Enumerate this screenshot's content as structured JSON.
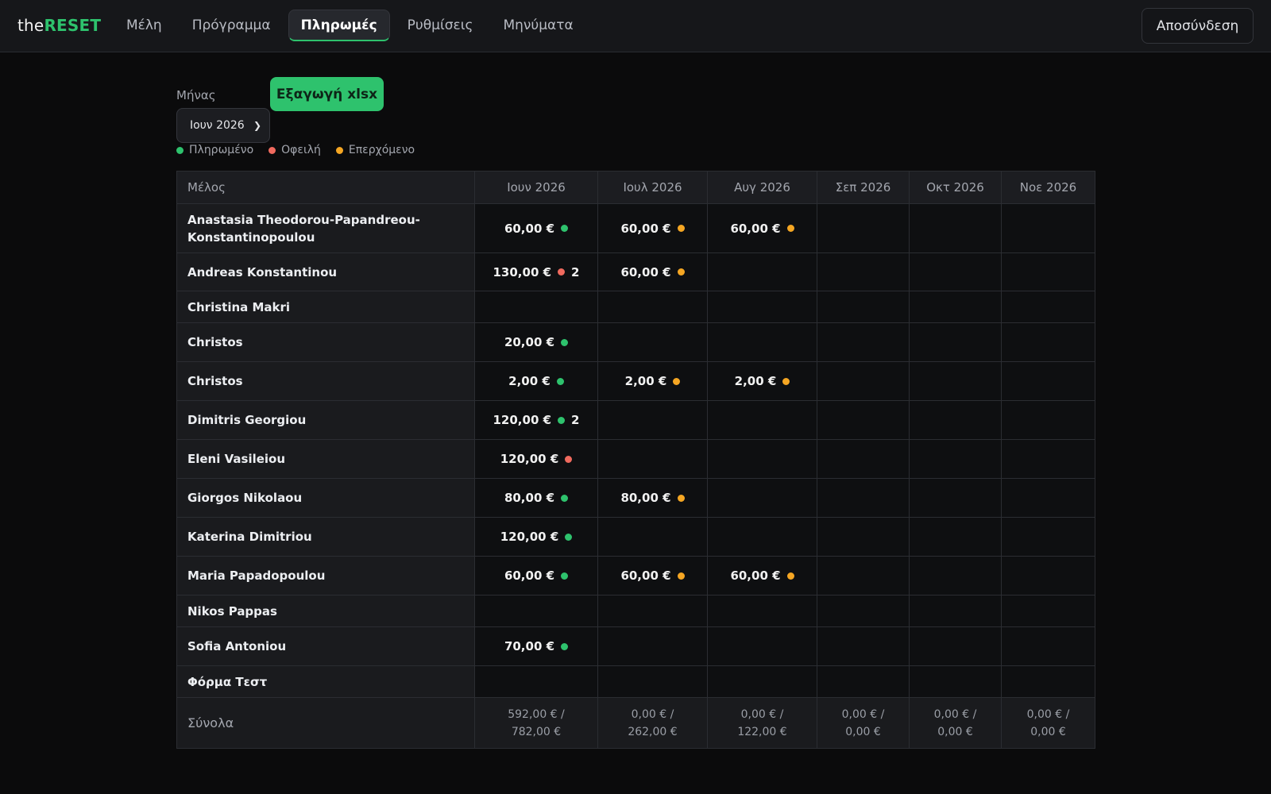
{
  "brand": {
    "prefix": "the",
    "accent": "RESET"
  },
  "nav": {
    "tabs": [
      {
        "label": "Μέλη",
        "active": false
      },
      {
        "label": "Πρόγραμμα",
        "active": false
      },
      {
        "label": "Πληρωμές",
        "active": true
      },
      {
        "label": "Ρυθμίσεις",
        "active": false
      },
      {
        "label": "Μηνύματα",
        "active": false
      }
    ],
    "logout_label": "Αποσύνδεση"
  },
  "controls": {
    "month_label": "Μήνας",
    "selected_month": "Ιουν 2026",
    "export_label": "Εξαγωγή xlsx"
  },
  "legend": [
    {
      "label": "Πληρωμένο",
      "color": "#2ec26d"
    },
    {
      "label": "Οφειλή",
      "color": "#f06a5e"
    },
    {
      "label": "Επερχόμενο",
      "color": "#f5a623"
    }
  ],
  "colors": {
    "paid": "#2ec26d",
    "owed": "#f06a5e",
    "upcoming": "#f5a623"
  },
  "table": {
    "member_header": "Μέλος",
    "months": [
      "Ιουν 2026",
      "Ιουλ 2026",
      "Αυγ 2026",
      "Σεπ 2026",
      "Οκτ 2026",
      "Νοε 2026"
    ],
    "rows": [
      {
        "name": "Anastasia Theodorou-Papandreou-Konstantinopoulou",
        "cells": [
          {
            "amount": "60,00 €",
            "status": "paid"
          },
          {
            "amount": "60,00 €",
            "status": "upcoming"
          },
          {
            "amount": "60,00 €",
            "status": "upcoming"
          },
          null,
          null,
          null
        ]
      },
      {
        "name": "Andreas Konstantinou",
        "cells": [
          {
            "amount": "130,00 €",
            "status": "owed",
            "count": "2"
          },
          {
            "amount": "60,00 €",
            "status": "upcoming"
          },
          null,
          null,
          null,
          null
        ]
      },
      {
        "name": "Christina Makri",
        "cells": [
          null,
          null,
          null,
          null,
          null,
          null
        ]
      },
      {
        "name": "Christos",
        "cells": [
          {
            "amount": "20,00 €",
            "status": "paid"
          },
          null,
          null,
          null,
          null,
          null
        ]
      },
      {
        "name": "Christos",
        "cells": [
          {
            "amount": "2,00 €",
            "status": "paid"
          },
          {
            "amount": "2,00 €",
            "status": "upcoming"
          },
          {
            "amount": "2,00 €",
            "status": "upcoming"
          },
          null,
          null,
          null
        ]
      },
      {
        "name": "Dimitris Georgiou",
        "cells": [
          {
            "amount": "120,00 €",
            "status": "paid",
            "count": "2"
          },
          null,
          null,
          null,
          null,
          null
        ]
      },
      {
        "name": "Eleni Vasileiou",
        "cells": [
          {
            "amount": "120,00 €",
            "status": "owed"
          },
          null,
          null,
          null,
          null,
          null
        ]
      },
      {
        "name": "Giorgos Nikolaou",
        "cells": [
          {
            "amount": "80,00 €",
            "status": "paid"
          },
          {
            "amount": "80,00 €",
            "status": "upcoming"
          },
          null,
          null,
          null,
          null
        ]
      },
      {
        "name": "Katerina Dimitriou",
        "cells": [
          {
            "amount": "120,00 €",
            "status": "paid"
          },
          null,
          null,
          null,
          null,
          null
        ]
      },
      {
        "name": "Maria Papadopoulou",
        "cells": [
          {
            "amount": "60,00 €",
            "status": "paid"
          },
          {
            "amount": "60,00 €",
            "status": "upcoming"
          },
          {
            "amount": "60,00 €",
            "status": "upcoming"
          },
          null,
          null,
          null
        ]
      },
      {
        "name": "Nikos Pappas",
        "cells": [
          null,
          null,
          null,
          null,
          null,
          null
        ]
      },
      {
        "name": "Sofia Antoniou",
        "cells": [
          {
            "amount": "70,00 €",
            "status": "paid"
          },
          null,
          null,
          null,
          null,
          null
        ]
      },
      {
        "name": "Φόρμα Τεστ",
        "cells": [
          null,
          null,
          null,
          null,
          null,
          null
        ]
      }
    ],
    "totals": {
      "label": "Σύνολα",
      "values": [
        [
          "592,00 € /",
          "782,00 €"
        ],
        [
          "0,00 € /",
          "262,00 €"
        ],
        [
          "0,00 € /",
          "122,00 €"
        ],
        [
          "0,00 € /",
          "0,00 €"
        ],
        [
          "0,00 € /",
          "0,00 €"
        ],
        [
          "0,00 € /",
          "0,00 €"
        ]
      ]
    }
  }
}
